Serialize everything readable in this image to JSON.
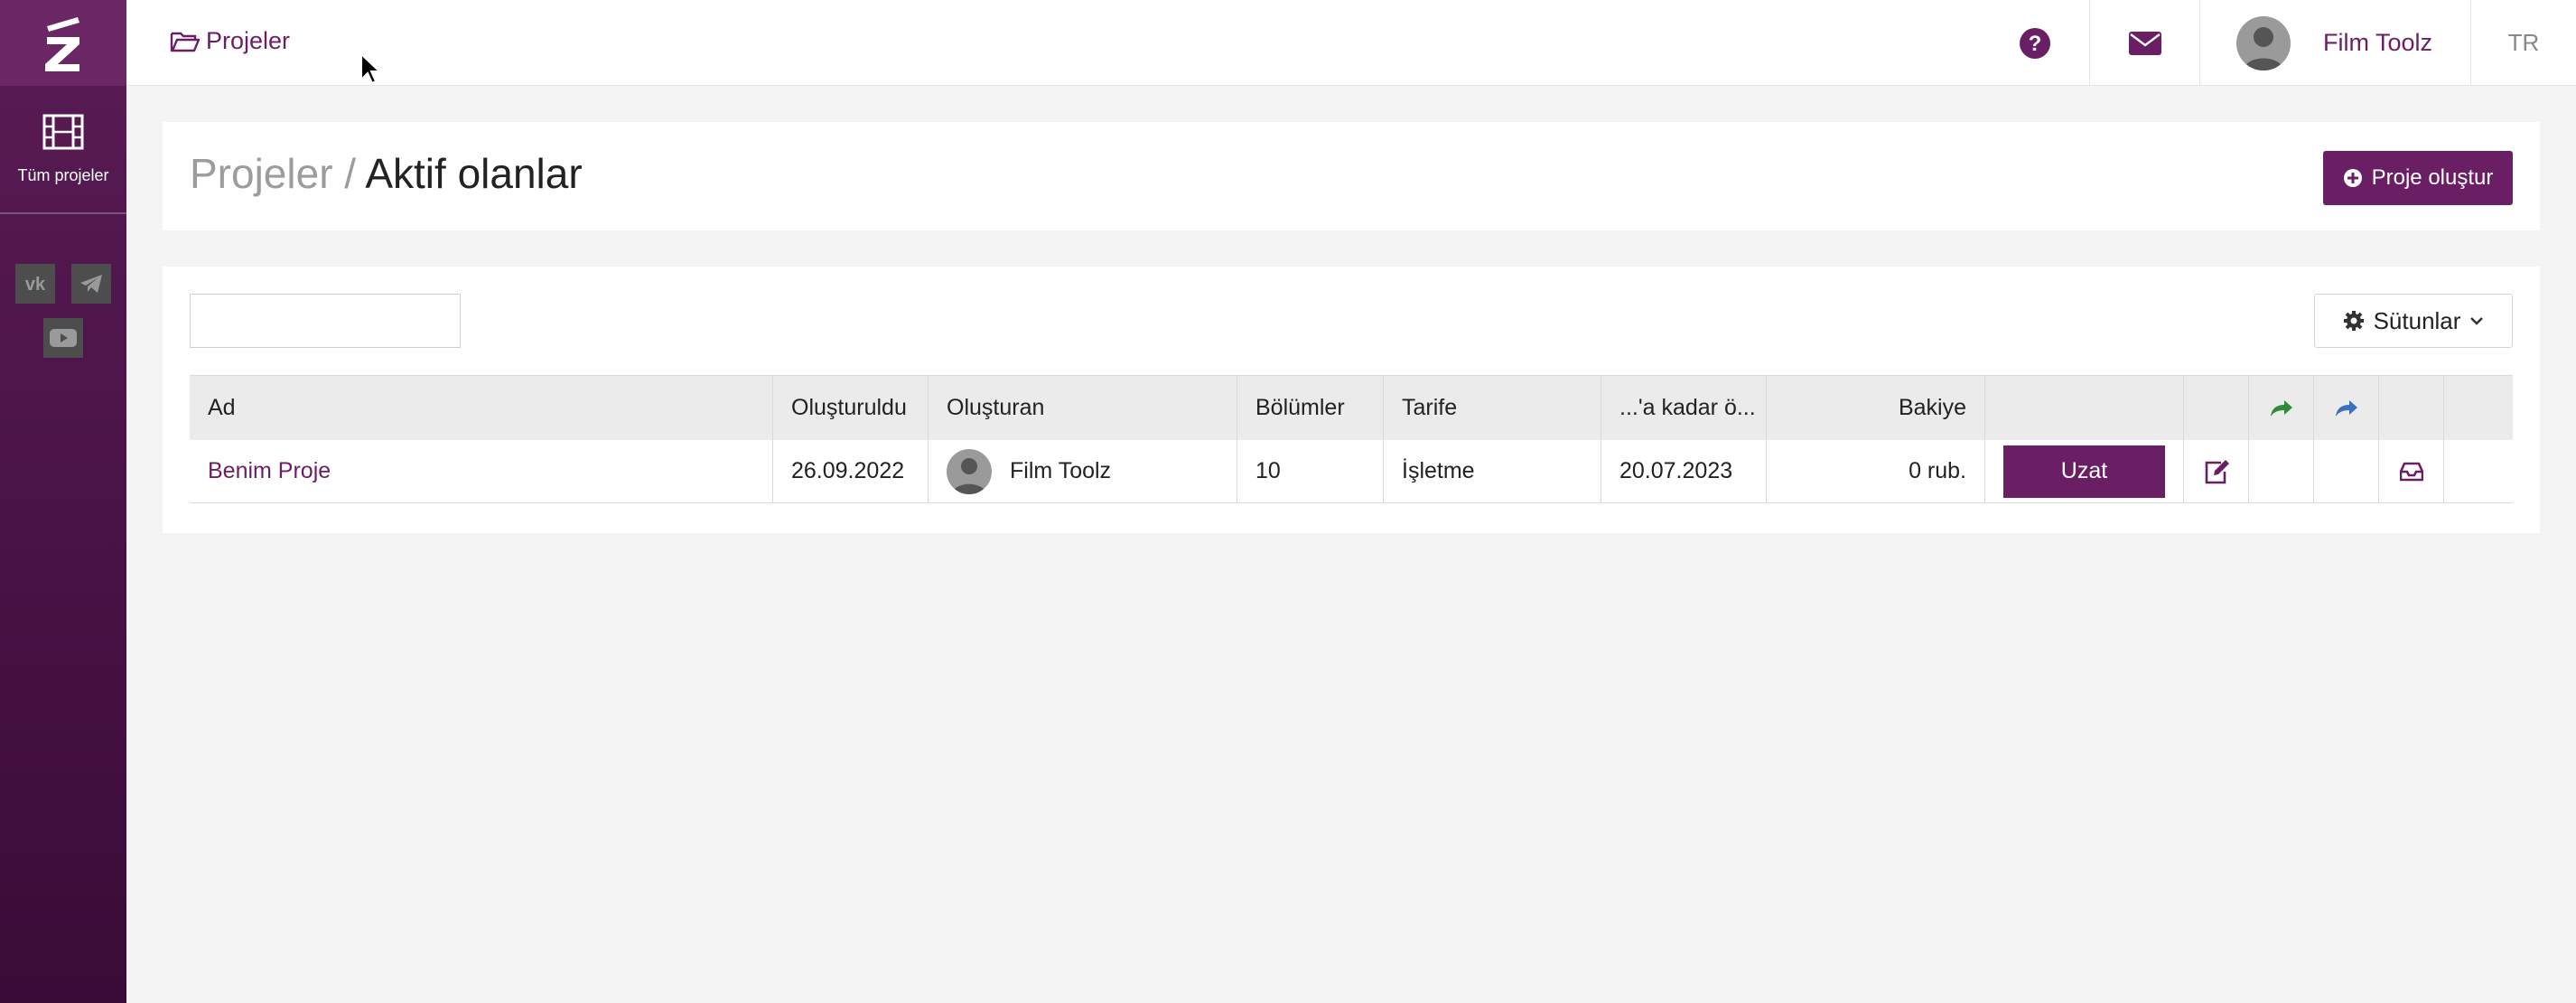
{
  "sidebar": {
    "logo_icon": "z-clapper-logo-icon",
    "nav": [
      {
        "label": "Tüm projeler",
        "icon": "film-icon"
      }
    ],
    "social": [
      "vk-icon",
      "telegram-icon",
      "youtube-icon"
    ]
  },
  "topbar": {
    "breadcrumb": "Projeler",
    "user_name": "Film Toolz",
    "language": "TR"
  },
  "page": {
    "title_parent": "Projeler /",
    "title_current": "Aktif olanlar",
    "create_button": "Proje oluştur"
  },
  "table": {
    "search": {
      "value": "",
      "placeholder": ""
    },
    "columns_button": "Sütunlar",
    "headers": {
      "name": "Ad",
      "created": "Oluşturuldu",
      "creator": "Oluşturan",
      "episodes": "Bölümler",
      "tariff": "Tarife",
      "until": "...'a kadar ö...",
      "balance": "Bakiye"
    },
    "rows": [
      {
        "name": "Benim Proje",
        "created": "26.09.2022",
        "creator": "Film Toolz",
        "episodes": "10",
        "tariff": "İşletme",
        "until": "20.07.2023",
        "balance": "0 rub.",
        "action": "Uzat"
      }
    ]
  },
  "colors": {
    "brand": "#6a1f65",
    "sidebar": "#4a1346",
    "share_green": "#2e8b3a",
    "share_blue": "#3a6fc4"
  }
}
